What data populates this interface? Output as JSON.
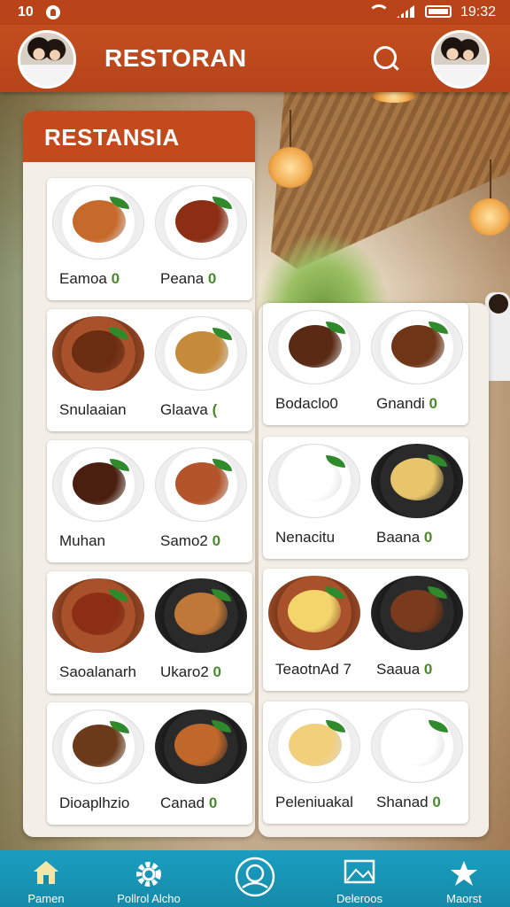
{
  "status_bar": {
    "left_text": "10",
    "time": "19:32"
  },
  "header": {
    "title": "RESTORAN"
  },
  "panel": {
    "title": "RESTANSIA"
  },
  "menu_items": [
    {
      "label": "Eamoa",
      "badge": "0"
    },
    {
      "label": "Peana",
      "badge": "0"
    },
    {
      "label": "Snulaaian",
      "badge": ""
    },
    {
      "label": "Glaava",
      "badge": "("
    },
    {
      "label": "Bodaclo0",
      "badge": ""
    },
    {
      "label": "Gnandi",
      "badge": "0"
    },
    {
      "label": "Muhan",
      "badge": ""
    },
    {
      "label": "Samo2",
      "badge": "0"
    },
    {
      "label": "Nenacitu",
      "badge": ""
    },
    {
      "label": "Baana",
      "badge": "0"
    },
    {
      "label": "Saoalanarh",
      "badge": ""
    },
    {
      "label": "Ukaro2",
      "badge": "0"
    },
    {
      "label": "TeaotnAd 7",
      "badge": ""
    },
    {
      "label": "Saaua",
      "badge": "0"
    },
    {
      "label": "Dioaplhzio",
      "badge": ""
    },
    {
      "label": "Canad",
      "badge": "0"
    },
    {
      "label": "Peleniuakal",
      "badge": ""
    },
    {
      "label": "Shanad",
      "badge": "0"
    }
  ],
  "nav": [
    {
      "label": "Pamen",
      "icon": "home-icon"
    },
    {
      "label": "Pollrol Alcho",
      "icon": "gear-icon"
    },
    {
      "label": "",
      "icon": "support-icon"
    },
    {
      "label": "Deleroos",
      "icon": "image-icon"
    },
    {
      "label": "Maorst",
      "icon": "star-icon"
    }
  ],
  "colors": {
    "header": "#c24e1f",
    "nav": "#1a9ec1",
    "badge": "#4a8a2a"
  }
}
